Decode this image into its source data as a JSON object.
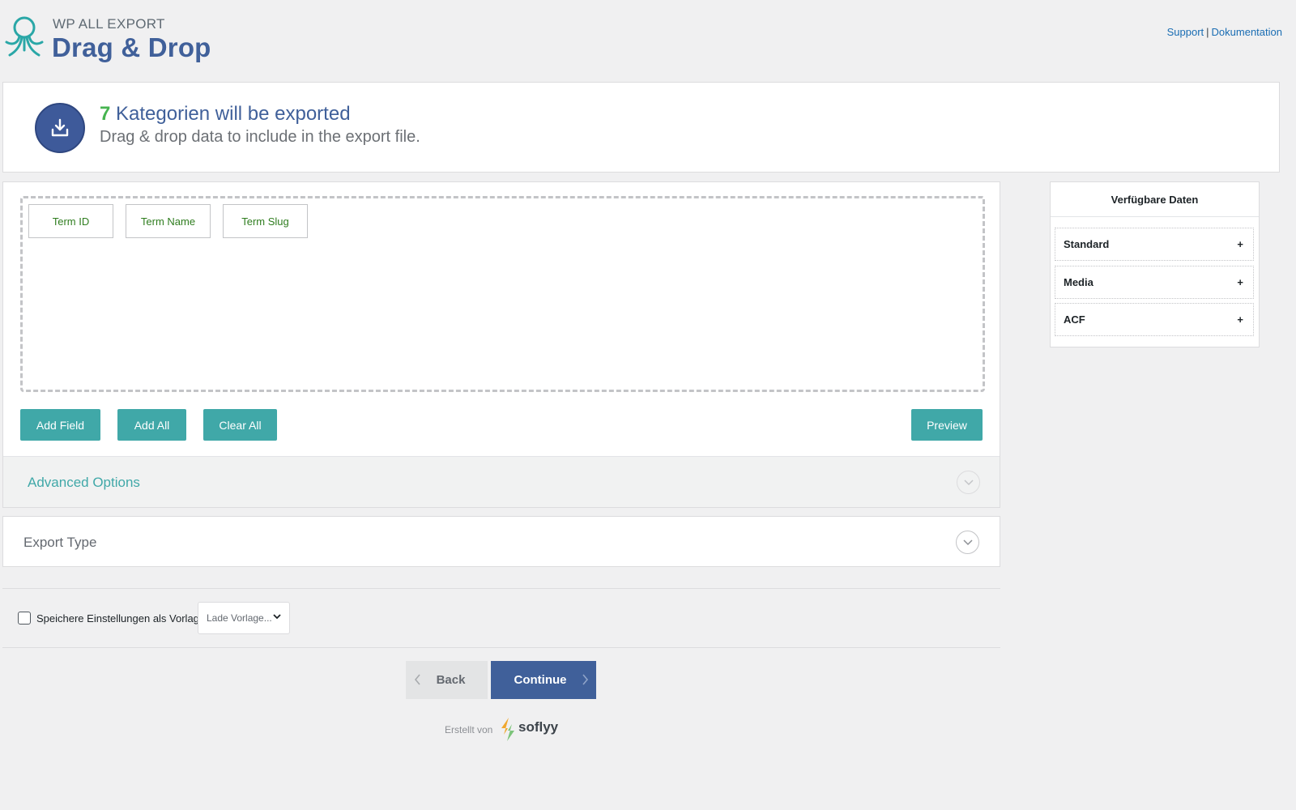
{
  "header": {
    "brand_sub": "WP ALL EXPORT",
    "title": "Drag & Drop",
    "links": {
      "support": "Support",
      "separator": "|",
      "docs": "Dokumentation"
    }
  },
  "banner": {
    "count": "7",
    "headline": " Kategorien will be exported",
    "subline": "Drag & drop data to include in the export file."
  },
  "fields": [
    "Term ID",
    "Term Name",
    "Term Slug"
  ],
  "buttons": {
    "add_field": "Add Field",
    "add_all": "Add All",
    "clear_all": "Clear All",
    "preview": "Preview"
  },
  "sections": {
    "advanced": "Advanced Options",
    "export_type": "Export Type"
  },
  "sidebar": {
    "title": "Verfügbare Daten",
    "items": [
      {
        "label": "Standard",
        "toggle": "+"
      },
      {
        "label": "Media",
        "toggle": "+"
      },
      {
        "label": "ACF",
        "toggle": "+"
      }
    ]
  },
  "template": {
    "checkbox_label": "Speichere Einstellungen als Vorlage",
    "checked": false,
    "select_value": "Lade Vorlage..."
  },
  "nav": {
    "back": "Back",
    "continue": "Continue"
  },
  "footer": {
    "made_by": "Erstellt von",
    "brand": "soflyy"
  },
  "colors": {
    "accent_teal": "#40a8a8",
    "primary_blue": "#40609a",
    "count_green": "#46b450",
    "field_green": "#2f7d1f"
  }
}
